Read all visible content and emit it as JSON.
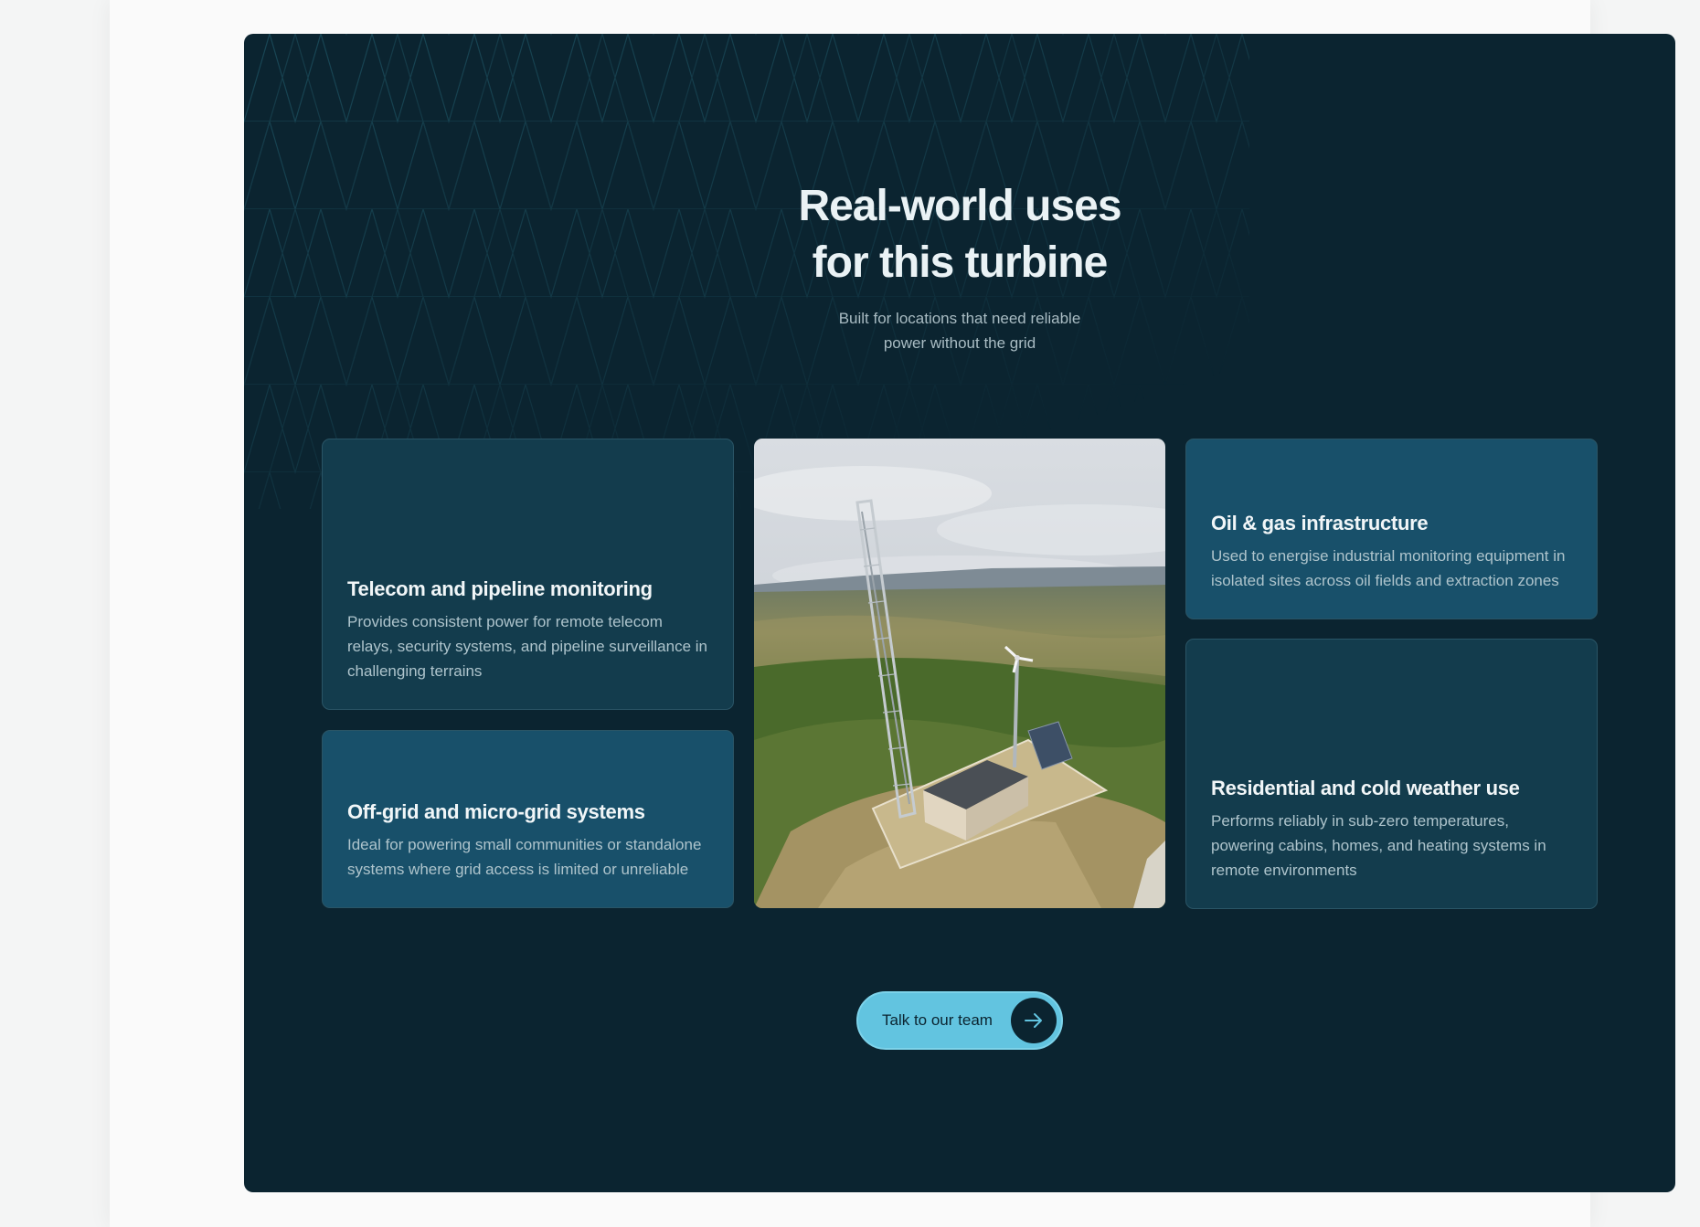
{
  "section": {
    "title_line1": "Real-world uses",
    "title_line2": "for this turbine",
    "subtitle": "Built for locations that need reliable power without the grid"
  },
  "cards": [
    {
      "title": "Telecom and pipeline monitoring",
      "text": "Provides consistent power for remote telecom relays, security systems, and pipeline surveillance in challenging terrains"
    },
    {
      "title": "Off-grid and micro-grid systems",
      "text": "Ideal for powering small communities or standalone systems where grid access is limited or unreliable"
    },
    {
      "title": "Oil & gas infrastructure",
      "text": "Used to energise industrial monitoring equipment in isolated sites across oil fields and extraction zones"
    },
    {
      "title": "Residential and cold weather use",
      "text": "Performs reliably in sub-zero temperatures, powering cabins, homes, and heating systems in remote environments"
    }
  ],
  "cta": {
    "label": "Talk to our team",
    "icon": "arrow-right-icon"
  },
  "colors": {
    "section_bg": "#0b2430",
    "card_dark": "#133c4d",
    "card_mid": "#18506a",
    "accent": "#62c4e0"
  }
}
